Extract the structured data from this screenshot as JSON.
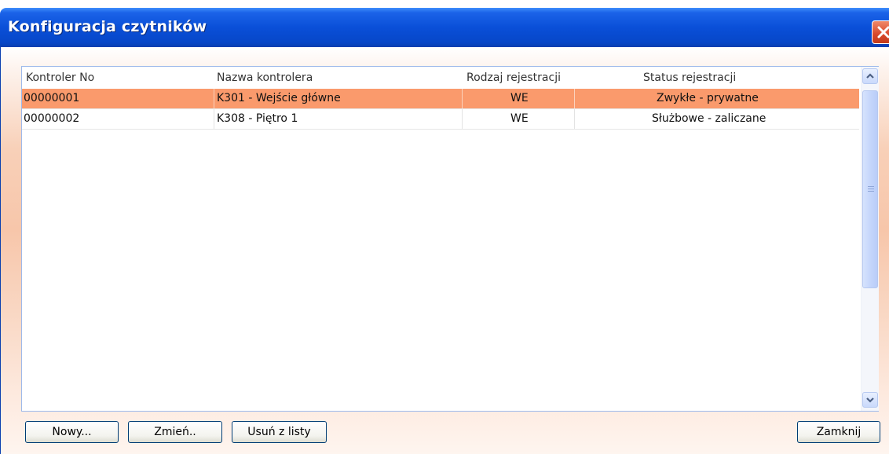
{
  "window": {
    "title": "Konfiguracja czytników"
  },
  "table": {
    "columns": [
      "Kontroler No",
      "Nazwa kontrolera",
      "Rodzaj rejestracji",
      "Status rejestracji"
    ],
    "rows": [
      {
        "no": "00000001",
        "name": "K301 - Wejście główne",
        "type": "WE",
        "status": "Zwykłe - prywatne",
        "selected": true
      },
      {
        "no": "00000002",
        "name": "K308 - Piętro 1",
        "type": "WE",
        "status": "Służbowe - zaliczane",
        "selected": false
      }
    ]
  },
  "buttons": {
    "new": "Nowy...",
    "edit": "Zmień..",
    "remove": "Usuń z listy",
    "close": "Zamknij"
  },
  "colors": {
    "selection": "#fa9a6c",
    "titlebar": "#0a4fd8",
    "close": "#d8482a"
  },
  "icons": {
    "close": "close-icon",
    "scroll_up": "chevron-up-icon",
    "scroll_down": "chevron-down-icon"
  }
}
